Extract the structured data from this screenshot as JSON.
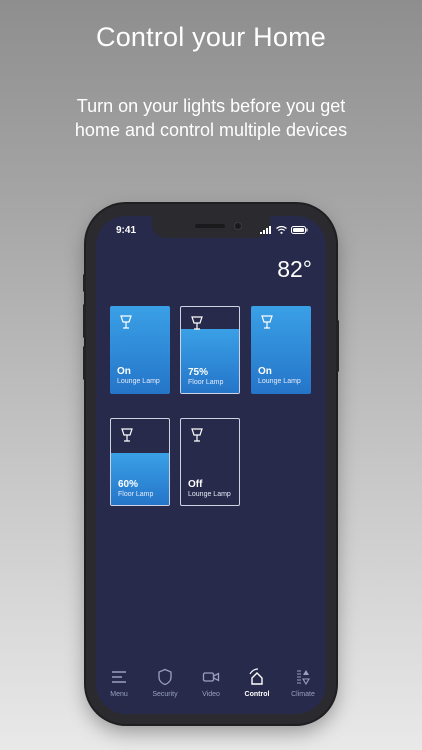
{
  "promo": {
    "title": "Control your Home",
    "subtitle": "Turn on your lights before you get home and control multiple devices"
  },
  "status": {
    "time": "9:41"
  },
  "screen": {
    "temperature": "82°"
  },
  "tiles": [
    {
      "value": "On",
      "name": "Lounge Lamp",
      "level": 100
    },
    {
      "value": "75%",
      "name": "Floor Lamp",
      "level": 75
    },
    {
      "value": "On",
      "name": "Lounge Lamp",
      "level": 100
    },
    {
      "value": "60%",
      "name": "Floor Lamp",
      "level": 60
    },
    {
      "value": "Off",
      "name": "Lounge Lamp",
      "level": 0
    }
  ],
  "tabs": [
    {
      "label": "Menu",
      "icon": "menu-icon",
      "active": false
    },
    {
      "label": "Security",
      "icon": "shield-icon",
      "active": false
    },
    {
      "label": "Video",
      "icon": "camera-icon",
      "active": false
    },
    {
      "label": "Control",
      "icon": "home-icon",
      "active": true
    },
    {
      "label": "Climate",
      "icon": "thermostat-icon",
      "active": false
    }
  ],
  "colors": {
    "accent": "#2f8ae0",
    "screen_bg": "#272a4a"
  }
}
